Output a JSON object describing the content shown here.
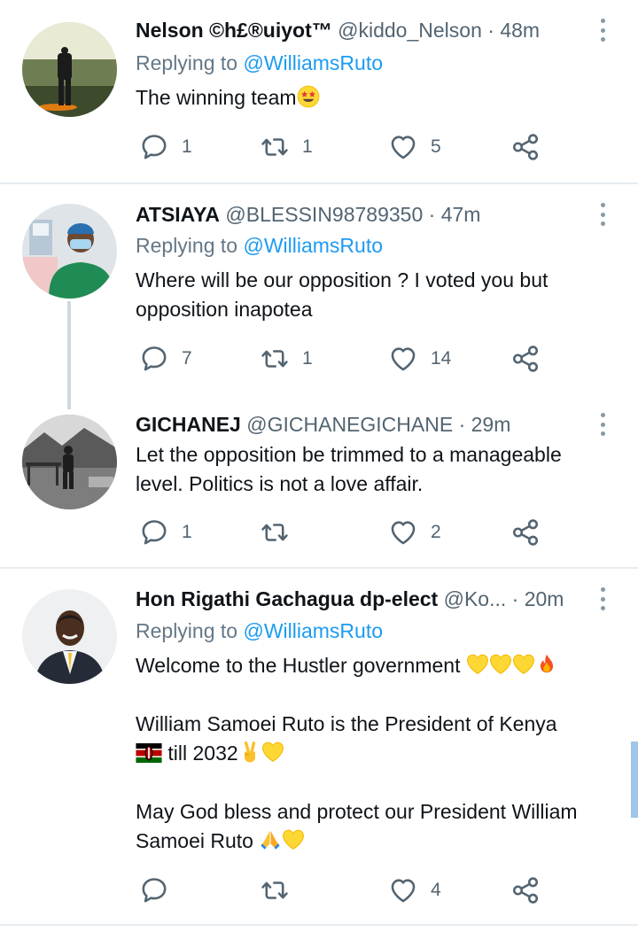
{
  "tweets": [
    {
      "name": "Nelson ©h£®uiyot™",
      "handle": "@kiddo_Nelson",
      "separator": "·",
      "time": "48m",
      "replying_prefix": "Replying to",
      "replying_to": "@WilliamsRuto",
      "text": [
        "The winning team"
      ],
      "text_emoji": "star-struck",
      "replies": "1",
      "retweets": "1",
      "likes": "5",
      "avatar": "man-in-field-photo"
    },
    {
      "name": "ATSIAYA",
      "handle": "@BLESSIN98789350",
      "separator": "·",
      "time": "47m",
      "replying_prefix": "Replying to",
      "replying_to": "@WilliamsRuto",
      "text": [
        "Where will be our opposition ? I voted you but",
        "opposition inapotea"
      ],
      "replies": "7",
      "retweets": "1",
      "likes": "14",
      "avatar": "medical-worker-photo"
    },
    {
      "name": "GICHANEJ",
      "handle": "@GICHANEGICHANE",
      "separator": "·",
      "time": "29m",
      "text": [
        "Let the opposition be trimmed to a manageable",
        "level. Politics is not a love affair."
      ],
      "replies": "1",
      "retweets": "",
      "likes": "2",
      "avatar": "man-outdoors-bw-photo"
    },
    {
      "name": "Hon Rigathi Gachagua dp-elect",
      "handle": "@Ko...",
      "separator": "·",
      "time": "20m",
      "replying_prefix": "Replying to",
      "replying_to": "@WilliamsRuto",
      "text_p1": "Welcome to the Hustler government",
      "text_p2a": "William Samoei Ruto is the President of Kenya",
      "text_p2b": "till 2032",
      "text_p3a": "May God bless and protect our President William",
      "text_p3b": "Samoei Ruto",
      "replies": "",
      "retweets": "",
      "likes": "4",
      "avatar": "man-in-suit-photo"
    }
  ],
  "icons": {
    "reply": "reply-icon",
    "retweet": "retweet-icon",
    "like": "heart-icon",
    "share": "share-icon",
    "more": "more-vertical-icon"
  },
  "colors": {
    "link": "#1d9bf0",
    "secondary": "#536471",
    "divider": "#e6ecf0",
    "thread_line": "#cfd9de"
  }
}
